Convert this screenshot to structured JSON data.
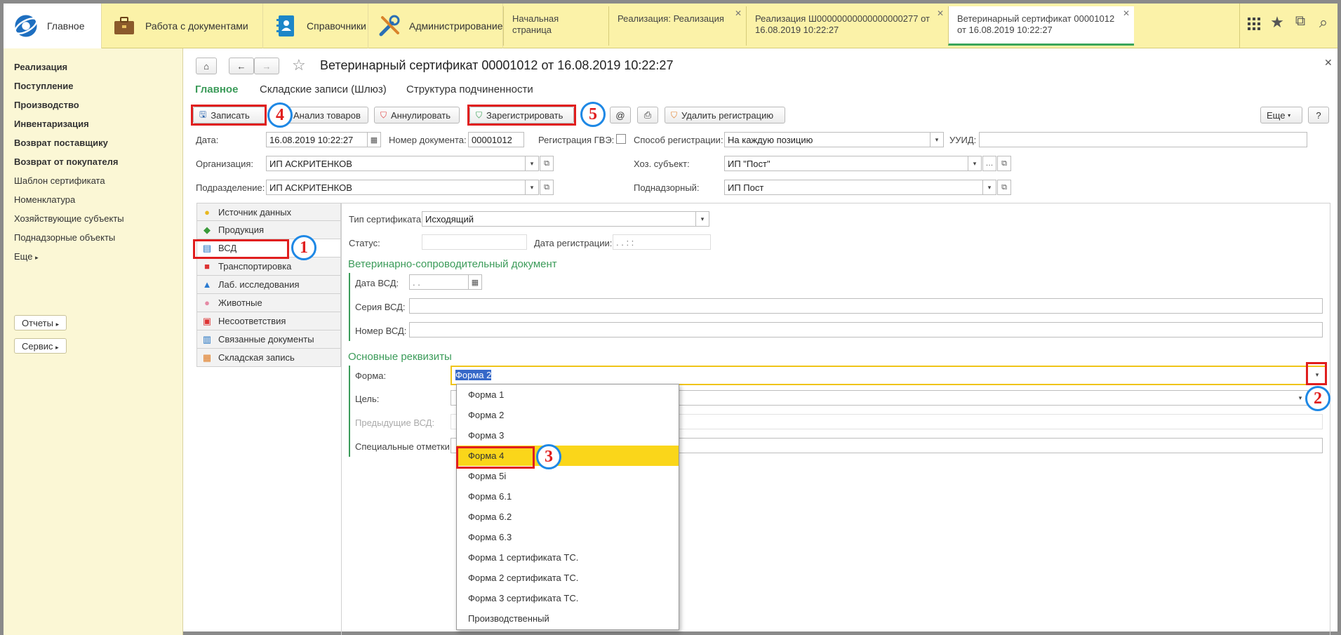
{
  "topbar": {
    "main_label": "Главное",
    "sections": [
      {
        "label": "Работа с документами",
        "icon": "briefcase-icon"
      },
      {
        "label": "Справочники",
        "icon": "address-book-icon"
      },
      {
        "label": "Администрирование",
        "icon": "tools-icon"
      }
    ],
    "tabs": [
      {
        "label": "Начальная страница",
        "closable": false
      },
      {
        "label": "Реализация: Реализация",
        "closable": true
      },
      {
        "label": "Реализация Ш00000000000000000277 от 16.08.2019 10:22:27",
        "closable": true
      },
      {
        "label": "Ветеринарный сертификат 00001012 от 16.08.2019 10:22:27",
        "closable": true,
        "active": true
      }
    ],
    "icons": [
      "grid-icon",
      "star-icon",
      "copy-icon",
      "search-icon"
    ]
  },
  "sidebar": {
    "bold_items": [
      "Реализация",
      "Поступление",
      "Производство",
      "Инвентаризация",
      "Возврат поставщику",
      "Возврат от покупателя"
    ],
    "items": [
      "Шаблон сертификата",
      "Номенклатура",
      "Хозяйствующие субъекты",
      "Поднадзорные объекты"
    ],
    "more_label": "Еще",
    "reports_label": "Отчеты",
    "service_label": "Сервис"
  },
  "doc": {
    "title": "Ветеринарный сертификат 00001012 от 16.08.2019 10:22:27",
    "nav": [
      "Главное",
      "Складские записи (Шлюз)",
      "Структура подчиненности"
    ],
    "toolbar": {
      "save": "Записать",
      "analysis": "Анализ товаров",
      "annul": "Аннулировать",
      "register": "Зарегистрировать",
      "at": "@",
      "unregister": "Удалить регистрацию",
      "more": "Еще",
      "help": "?"
    },
    "fields": {
      "date_label": "Дата:",
      "date_value": "16.08.2019 10:22:27",
      "docnum_label": "Номер документа:",
      "docnum_value": "00001012",
      "gvz_label": "Регистрация ГВЭ:",
      "method_label": "Способ регистрации:",
      "method_value": "На каждую позицию",
      "uuid_label": "УУИД:",
      "uuid_value": "",
      "org_label": "Организация:",
      "org_value": "ИП АСКРИТЕНКОВ",
      "subject_label": "Хоз. субъект:",
      "subject_value": "ИП \"Пост\"",
      "dept_label": "Подразделение:",
      "dept_value": "ИП АСКРИТЕНКОВ",
      "supervised_label": "Поднадзорный:",
      "supervised_value": "ИП Пост"
    },
    "pages": [
      {
        "label": "Источник данных",
        "icon": "lightbulb-icon"
      },
      {
        "label": "Продукция",
        "icon": "basket-icon"
      },
      {
        "label": "ВСД",
        "icon": "document-icon"
      },
      {
        "label": "Транспортировка",
        "icon": "truck-icon"
      },
      {
        "label": "Лаб. исследования",
        "icon": "flask-icon"
      },
      {
        "label": "Животные",
        "icon": "pig-icon"
      },
      {
        "label": "Несоответствия",
        "icon": "warning-doc-icon"
      },
      {
        "label": "Связанные документы",
        "icon": "linked-docs-icon"
      },
      {
        "label": "Складская запись",
        "icon": "warehouse-icon"
      }
    ],
    "vsd": {
      "cert_type_label": "Тип сертификата:",
      "cert_type_value": "Исходящий",
      "status_label": "Статус:",
      "status_value": "",
      "reg_date_label": "Дата регистрации:",
      "reg_date_value": " .  .     :  :",
      "section1": "Ветеринарно-сопроводительный документ",
      "vsd_date_label": "Дата ВСД:",
      "vsd_date_value": " .  .",
      "series_label": "Серия ВСД:",
      "number_label": "Номер ВСД:",
      "section2": "Основные реквизиты",
      "form_label": "Форма:",
      "form_value": "Форма 2",
      "purpose_label": "Цель:",
      "prev_label": "Предыдущие ВСД:",
      "special_label": "Специальные отметки:"
    },
    "dropdown": [
      "Форма 1",
      "Форма 2",
      "Форма 3",
      "Форма 4",
      "Форма 5i",
      "Форма 6.1",
      "Форма 6.2",
      "Форма 6.3",
      "Форма 1 сертификата ТС.",
      "Форма 2 сертификата ТС.",
      "Форма 3 сертификата ТС.",
      "Производственный"
    ],
    "dropdown_highlight": "Форма 4"
  },
  "annotations": [
    "1",
    "2",
    "3",
    "4",
    "5"
  ],
  "colors": {
    "accent": "#3b9b59",
    "highlight": "#fad61a",
    "marker": "#e01e1e",
    "circle": "#1e88e5",
    "topbar": "#fbf2a8"
  }
}
